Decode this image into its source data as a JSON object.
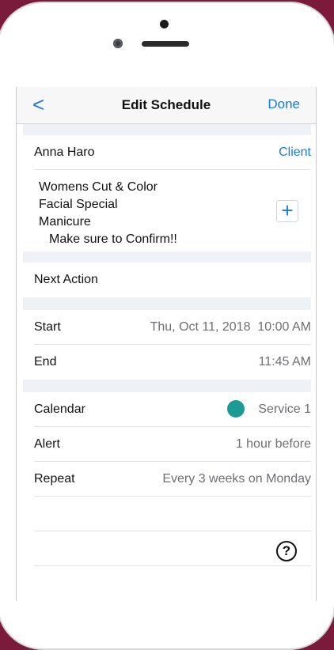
{
  "nav": {
    "back": "<",
    "title": "Edit Schedule",
    "done": "Done"
  },
  "client": {
    "name": "Anna Haro",
    "link": "Client"
  },
  "services": {
    "lines": [
      "Womens Cut & Color",
      "Facial Special",
      "Manicure"
    ],
    "note": "Make sure to Confirm!!",
    "add_icon": "plus-icon",
    "add_glyph": "+"
  },
  "next_action": {
    "label": "Next Action"
  },
  "start": {
    "label": "Start",
    "value": "Thu, Oct 11, 2018  10:00 AM"
  },
  "end": {
    "label": "End",
    "value": "11:45 AM"
  },
  "calendar": {
    "label": "Calendar",
    "value": "Service 1",
    "color": "#1e9a95"
  },
  "alert": {
    "label": "Alert",
    "value": "1 hour before"
  },
  "repeat": {
    "label": "Repeat",
    "value": "Every 3 weeks on Monday"
  },
  "help": {
    "icon": "question-circle-icon",
    "glyph": "?"
  },
  "colors": {
    "accent": "#1a7ad6",
    "background": "#7a1b3c",
    "section_band": "#eef1f6"
  }
}
